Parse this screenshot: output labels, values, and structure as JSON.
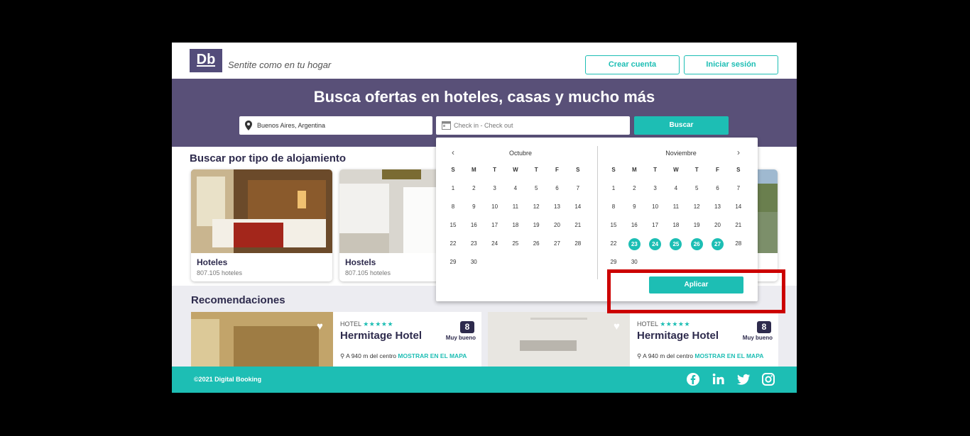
{
  "header": {
    "logo": "Db",
    "tagline": "Sentite como en tu hogar",
    "create_account": "Crear cuenta",
    "login": "Iniciar sesión"
  },
  "hero": {
    "title": "Busca ofertas en hoteles, casas y mucho más",
    "destination_value": "Buenos Aires, Argentina",
    "dates_placeholder": "Check in - Check out",
    "search_button": "Buscar"
  },
  "types": {
    "title": "Buscar por tipo de alojamiento",
    "cards": [
      {
        "name": "Hoteles",
        "count": "807.105 hoteles"
      },
      {
        "name": "Hostels",
        "count": "807.105 hoteles"
      }
    ]
  },
  "recommendations": {
    "title": "Recomendaciones",
    "items": [
      {
        "category": "HOTEL",
        "stars": "★★★★★",
        "name": "Hermitage Hotel",
        "score": "8",
        "score_label": "Muy bueno",
        "location": "A 940 m del centro",
        "map_link": "MOSTRAR EN EL MAPA"
      },
      {
        "category": "HOTEL",
        "stars": "★★★★★",
        "name": "Hermitage Hotel",
        "score": "8",
        "score_label": "Muy bueno",
        "location": "A 940 m del centro",
        "map_link": "MOSTRAR EN EL MAPA"
      }
    ]
  },
  "calendar": {
    "dow": [
      "S",
      "M",
      "T",
      "W",
      "T",
      "F",
      "S"
    ],
    "months": [
      {
        "name": "Octubre",
        "days": 30,
        "start_col": 0,
        "selected": []
      },
      {
        "name": "Noviembre",
        "days": 30,
        "start_col": 0,
        "selected": [
          23,
          24,
          25,
          26,
          27
        ]
      }
    ],
    "apply_button": "Aplicar"
  },
  "footer": {
    "copyright": "©2021 Digital Booking",
    "social": [
      "facebook-icon",
      "linkedin-icon",
      "twitter-icon",
      "instagram-icon"
    ]
  },
  "colors": {
    "primary": "#595078",
    "accent": "#1dbeb4",
    "dark": "#2e2b4d",
    "highlight": "#cc0000"
  }
}
